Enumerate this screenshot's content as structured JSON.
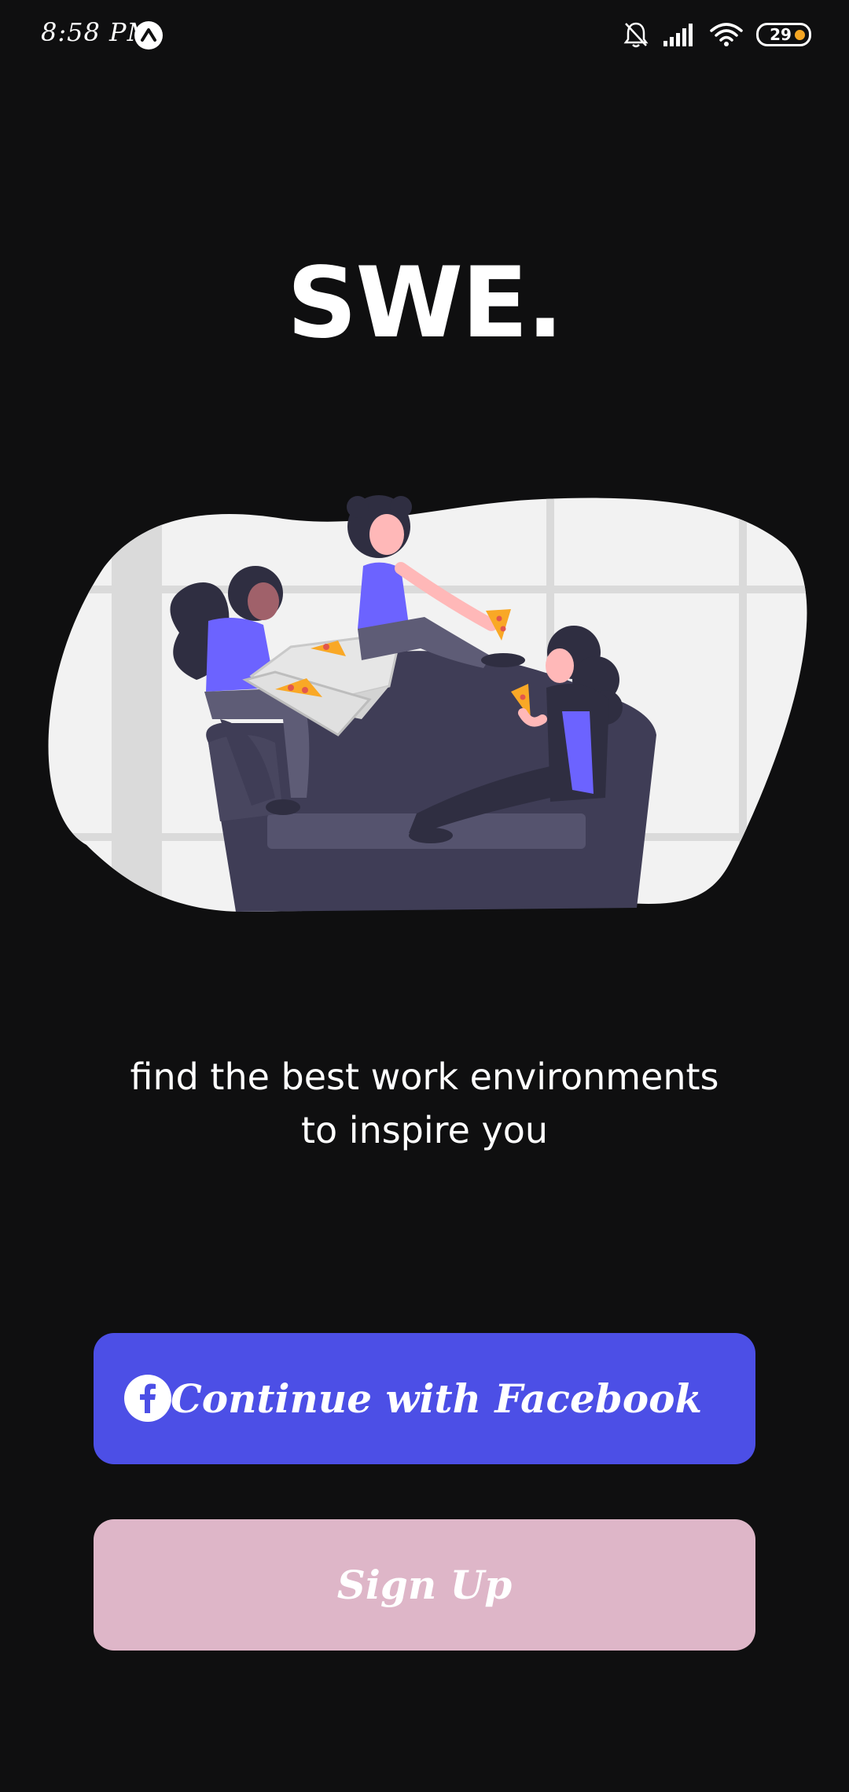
{
  "status_bar": {
    "time": "8:58 PM",
    "battery_level": "29",
    "icons": [
      "app-notification-icon",
      "bell-muted-icon",
      "signal-icon",
      "wifi-icon",
      "battery-icon"
    ]
  },
  "app": {
    "logo_text": "SWE.",
    "tagline": "find the best work environments to inspire you",
    "hero_image": "people-relaxing-on-couch-with-pizza-illustration"
  },
  "actions": {
    "facebook_label": "Continue with Facebook",
    "facebook_icon": "facebook-icon",
    "signup_label": "Sign Up"
  },
  "colors": {
    "background": "#0f0f10",
    "facebook_button": "#4c4fe6",
    "signup_button": "#deb6c8",
    "accent_purple": "#6c63ff"
  }
}
